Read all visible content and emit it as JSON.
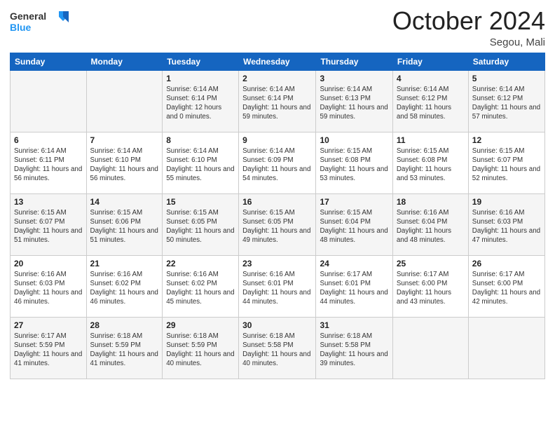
{
  "header": {
    "logo_general": "General",
    "logo_blue": "Blue",
    "month_title": "October 2024",
    "location": "Segou, Mali"
  },
  "days_of_week": [
    "Sunday",
    "Monday",
    "Tuesday",
    "Wednesday",
    "Thursday",
    "Friday",
    "Saturday"
  ],
  "weeks": [
    [
      {
        "day": "",
        "info": ""
      },
      {
        "day": "",
        "info": ""
      },
      {
        "day": "1",
        "info": "Sunrise: 6:14 AM\nSunset: 6:14 PM\nDaylight: 12 hours and 0 minutes."
      },
      {
        "day": "2",
        "info": "Sunrise: 6:14 AM\nSunset: 6:14 PM\nDaylight: 11 hours and 59 minutes."
      },
      {
        "day": "3",
        "info": "Sunrise: 6:14 AM\nSunset: 6:13 PM\nDaylight: 11 hours and 59 minutes."
      },
      {
        "day": "4",
        "info": "Sunrise: 6:14 AM\nSunset: 6:12 PM\nDaylight: 11 hours and 58 minutes."
      },
      {
        "day": "5",
        "info": "Sunrise: 6:14 AM\nSunset: 6:12 PM\nDaylight: 11 hours and 57 minutes."
      }
    ],
    [
      {
        "day": "6",
        "info": "Sunrise: 6:14 AM\nSunset: 6:11 PM\nDaylight: 11 hours and 56 minutes."
      },
      {
        "day": "7",
        "info": "Sunrise: 6:14 AM\nSunset: 6:10 PM\nDaylight: 11 hours and 56 minutes."
      },
      {
        "day": "8",
        "info": "Sunrise: 6:14 AM\nSunset: 6:10 PM\nDaylight: 11 hours and 55 minutes."
      },
      {
        "day": "9",
        "info": "Sunrise: 6:14 AM\nSunset: 6:09 PM\nDaylight: 11 hours and 54 minutes."
      },
      {
        "day": "10",
        "info": "Sunrise: 6:15 AM\nSunset: 6:08 PM\nDaylight: 11 hours and 53 minutes."
      },
      {
        "day": "11",
        "info": "Sunrise: 6:15 AM\nSunset: 6:08 PM\nDaylight: 11 hours and 53 minutes."
      },
      {
        "day": "12",
        "info": "Sunrise: 6:15 AM\nSunset: 6:07 PM\nDaylight: 11 hours and 52 minutes."
      }
    ],
    [
      {
        "day": "13",
        "info": "Sunrise: 6:15 AM\nSunset: 6:07 PM\nDaylight: 11 hours and 51 minutes."
      },
      {
        "day": "14",
        "info": "Sunrise: 6:15 AM\nSunset: 6:06 PM\nDaylight: 11 hours and 51 minutes."
      },
      {
        "day": "15",
        "info": "Sunrise: 6:15 AM\nSunset: 6:05 PM\nDaylight: 11 hours and 50 minutes."
      },
      {
        "day": "16",
        "info": "Sunrise: 6:15 AM\nSunset: 6:05 PM\nDaylight: 11 hours and 49 minutes."
      },
      {
        "day": "17",
        "info": "Sunrise: 6:15 AM\nSunset: 6:04 PM\nDaylight: 11 hours and 48 minutes."
      },
      {
        "day": "18",
        "info": "Sunrise: 6:16 AM\nSunset: 6:04 PM\nDaylight: 11 hours and 48 minutes."
      },
      {
        "day": "19",
        "info": "Sunrise: 6:16 AM\nSunset: 6:03 PM\nDaylight: 11 hours and 47 minutes."
      }
    ],
    [
      {
        "day": "20",
        "info": "Sunrise: 6:16 AM\nSunset: 6:03 PM\nDaylight: 11 hours and 46 minutes."
      },
      {
        "day": "21",
        "info": "Sunrise: 6:16 AM\nSunset: 6:02 PM\nDaylight: 11 hours and 46 minutes."
      },
      {
        "day": "22",
        "info": "Sunrise: 6:16 AM\nSunset: 6:02 PM\nDaylight: 11 hours and 45 minutes."
      },
      {
        "day": "23",
        "info": "Sunrise: 6:16 AM\nSunset: 6:01 PM\nDaylight: 11 hours and 44 minutes."
      },
      {
        "day": "24",
        "info": "Sunrise: 6:17 AM\nSunset: 6:01 PM\nDaylight: 11 hours and 44 minutes."
      },
      {
        "day": "25",
        "info": "Sunrise: 6:17 AM\nSunset: 6:00 PM\nDaylight: 11 hours and 43 minutes."
      },
      {
        "day": "26",
        "info": "Sunrise: 6:17 AM\nSunset: 6:00 PM\nDaylight: 11 hours and 42 minutes."
      }
    ],
    [
      {
        "day": "27",
        "info": "Sunrise: 6:17 AM\nSunset: 5:59 PM\nDaylight: 11 hours and 41 minutes."
      },
      {
        "day": "28",
        "info": "Sunrise: 6:18 AM\nSunset: 5:59 PM\nDaylight: 11 hours and 41 minutes."
      },
      {
        "day": "29",
        "info": "Sunrise: 6:18 AM\nSunset: 5:59 PM\nDaylight: 11 hours and 40 minutes."
      },
      {
        "day": "30",
        "info": "Sunrise: 6:18 AM\nSunset: 5:58 PM\nDaylight: 11 hours and 40 minutes."
      },
      {
        "day": "31",
        "info": "Sunrise: 6:18 AM\nSunset: 5:58 PM\nDaylight: 11 hours and 39 minutes."
      },
      {
        "day": "",
        "info": ""
      },
      {
        "day": "",
        "info": ""
      }
    ]
  ]
}
